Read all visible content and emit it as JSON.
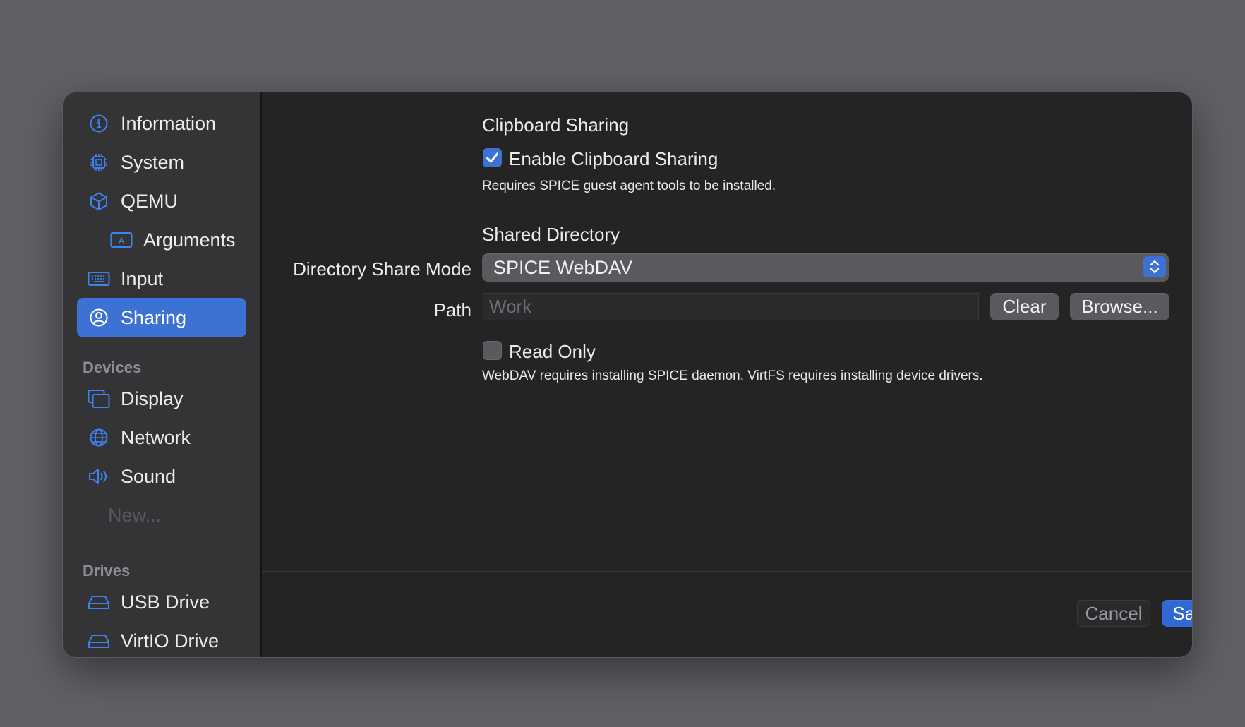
{
  "sidebar": {
    "items": [
      {
        "label": "Information",
        "icon": "info-icon"
      },
      {
        "label": "System",
        "icon": "cpu-icon"
      },
      {
        "label": "QEMU",
        "icon": "cube-icon"
      },
      {
        "label": "Arguments",
        "icon": "text-field-icon"
      },
      {
        "label": "Input",
        "icon": "keyboard-icon"
      },
      {
        "label": "Sharing",
        "icon": "person-circle-icon",
        "selected": true
      }
    ],
    "devices_header": "Devices",
    "devices": [
      {
        "label": "Display",
        "icon": "display-icon"
      },
      {
        "label": "Network",
        "icon": "globe-icon"
      },
      {
        "label": "Sound",
        "icon": "speaker-icon"
      }
    ],
    "new_placeholder": "New...",
    "drives_header": "Drives",
    "drives": [
      {
        "label": "USB Drive",
        "icon": "drive-icon"
      },
      {
        "label": "VirtIO Drive",
        "icon": "drive-icon"
      }
    ]
  },
  "clipboard": {
    "heading": "Clipboard Sharing",
    "enable_label": "Enable Clipboard Sharing",
    "enable_checked": true,
    "hint": "Requires SPICE guest agent tools to be installed."
  },
  "shared_directory": {
    "heading": "Shared Directory",
    "mode_label": "Directory Share Mode",
    "mode_value": "SPICE WebDAV",
    "path_label": "Path",
    "path_placeholder": "Work",
    "clear_label": "Clear",
    "browse_label": "Browse...",
    "read_only_label": "Read Only",
    "read_only_checked": false,
    "hint": "WebDAV requires installing SPICE daemon. VirtFS requires installing device drivers."
  },
  "footer": {
    "cancel_label": "Cancel",
    "save_label": "Save"
  },
  "colors": {
    "accent": "#3c72d4",
    "sidebar_bg": "#343437",
    "content_bg": "#242424",
    "backdrop": "#616066"
  }
}
